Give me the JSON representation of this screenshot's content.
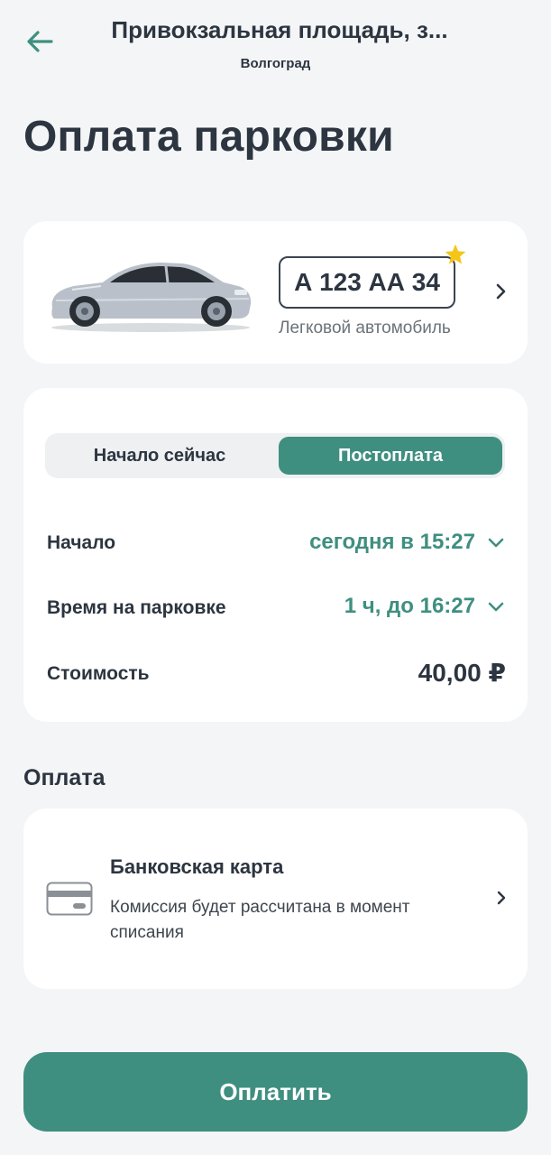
{
  "header": {
    "title": "Привокзальная площадь, з...",
    "subtitle": "Волгоград",
    "back_icon": "arrow-left-icon"
  },
  "page_title": "Оплата парковки",
  "vehicle": {
    "plate": "А 123 АА 34",
    "type": "Легковой автомобиль",
    "is_favorite": true,
    "favorite_icon": "star-icon",
    "arrow_icon": "chevron-right-icon"
  },
  "parking": {
    "mode_tabs": [
      "Начало сейчас",
      "Постоплата"
    ],
    "selected_tab": "Постоплата",
    "start_label": "Начало",
    "start_value": "сегодня в 15:27",
    "duration_label": "Время на парковке",
    "duration_value": "1 ч, до 16:27",
    "cost_label": "Стоимость",
    "cost_value": "40,00 ₽"
  },
  "payment": {
    "section_title": "Оплата",
    "method_title": "Банковская карта",
    "method_description": "Комиссия будет рассчитана в момент списания",
    "method_icon": "bank-card-icon"
  },
  "pay_button_label": "Оплатить",
  "colors": {
    "accent": "#3f8f80",
    "text": "#2c3540",
    "background": "#f4f5f7",
    "card": "#ffffff",
    "star": "#f5c518"
  }
}
